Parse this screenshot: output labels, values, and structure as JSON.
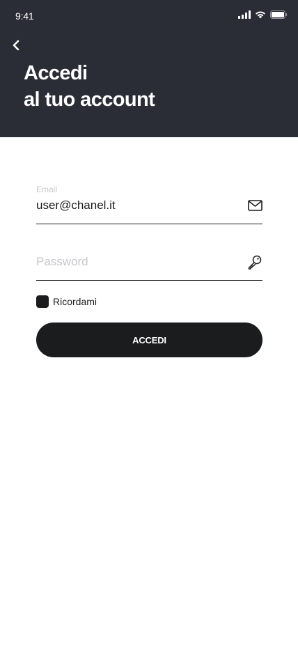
{
  "status_bar": {
    "time": "9:41",
    "icons": [
      "signal-icon",
      "wifi-icon",
      "battery-icon"
    ]
  },
  "header": {
    "back_icon": "chevron-left-icon",
    "title_line1": "Accedi",
    "title_line2": "al tuo account",
    "background_color": "#2a2d36"
  },
  "form": {
    "email": {
      "label": "Email",
      "value": "user@chanel.it",
      "icon": "envelope-icon"
    },
    "password": {
      "placeholder": "Password",
      "value": "",
      "icon": "key-icon"
    },
    "remember": {
      "label": "Ricordami",
      "checked": true
    },
    "submit_label": "ACCEDI",
    "button_color": "#1b1c1e"
  }
}
